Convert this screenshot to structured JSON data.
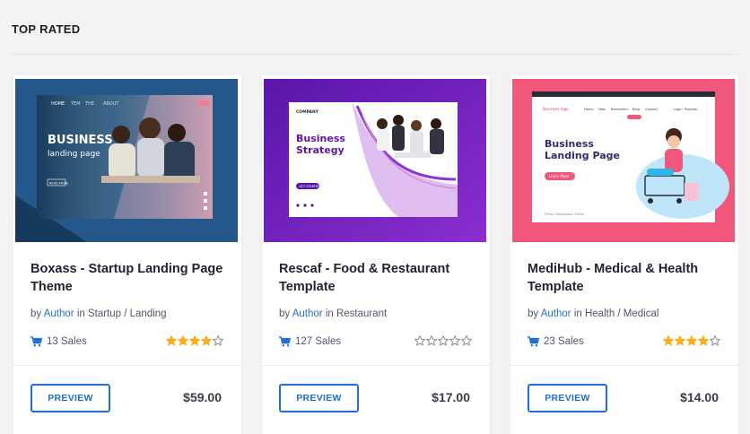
{
  "section": {
    "title": "TOP RATED"
  },
  "cards": [
    {
      "title": "Boxass - Startup Landing Page Theme",
      "by": "by",
      "author": "Author",
      "in": "in",
      "category": "Startup / Landing",
      "sales": "13 Sales",
      "rating": 4,
      "price": "$59.00",
      "preview_label": "PREVIEW",
      "thumb": {
        "nav": [
          "HOME",
          "TEM",
          "THE",
          "ABOUT"
        ],
        "headline_1": "BUSINESS",
        "headline_2": "landing page",
        "button": "READ MORE"
      }
    },
    {
      "title": "Rescaf - Food & Restaurant Template",
      "by": "by",
      "author": "Author",
      "in": "in",
      "category": "Restaurant",
      "sales": "127 Sales",
      "rating": 0,
      "price": "$17.00",
      "preview_label": "PREVIEW",
      "thumb": {
        "brand": "COMPANY",
        "headline_1": "Business",
        "headline_2": "Strategy",
        "button": "GET STARTED"
      }
    },
    {
      "title": "MediHub - Medical & Health Template",
      "by": "by",
      "author": "Author",
      "in": "in",
      "category": "Health / Medical",
      "sales": "23 Sales",
      "rating": 4,
      "price": "$14.00",
      "preview_label": "PREVIEW",
      "thumb": {
        "brand": "Business logo",
        "nav": [
          "Home",
          "New",
          "Bestsellers",
          "Blog",
          "Contact"
        ],
        "login": "Login",
        "register": "Register",
        "headline_1": "Business",
        "headline_2": "Landing Page",
        "button": "Learn More",
        "footer": "Prices, Designated, Media"
      }
    }
  ],
  "colors": {
    "accent": "#1f6fd6",
    "star_filled": "#f5b21d",
    "star_empty": "#8a8a96",
    "thumb1_bg": "#1f4d7a",
    "thumb2_bg": "#6a1fb4",
    "thumb3_bg": "#f2567a"
  },
  "icons": {
    "cart": "cart-icon",
    "star": "star-icon"
  }
}
